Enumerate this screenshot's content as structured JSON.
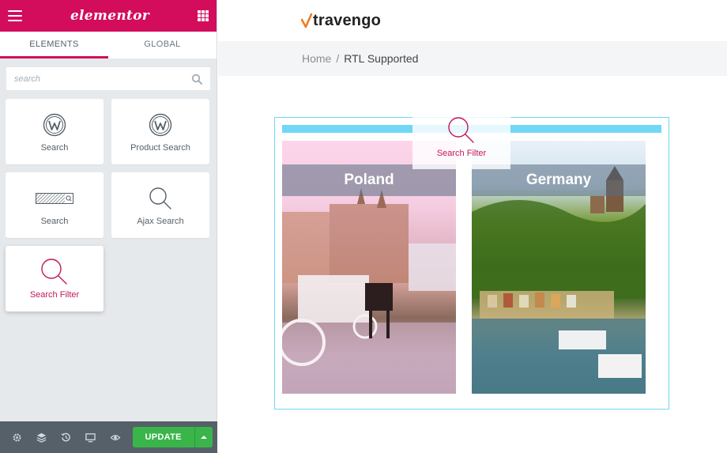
{
  "sidebar": {
    "brand": "elementor",
    "tabs": [
      {
        "label": "ELEMENTS",
        "active": true
      },
      {
        "label": "GLOBAL",
        "active": false
      }
    ],
    "search": {
      "placeholder": "search",
      "value": ""
    },
    "widgets": [
      {
        "label": "Search",
        "icon": "wordpress-icon"
      },
      {
        "label": "Product Search",
        "icon": "wordpress-icon"
      },
      {
        "label": "Search",
        "icon": "search-form-icon"
      },
      {
        "label": "Ajax Search",
        "icon": "magnifier-icon"
      },
      {
        "label": "Search Filter",
        "icon": "magnifier-icon"
      }
    ],
    "bottom": {
      "update_label": "UPDATE"
    }
  },
  "preview": {
    "logo_text": "travengo",
    "breadcrumb": {
      "home": "Home",
      "separator": "/",
      "current": "RTL Supported"
    },
    "cards": [
      {
        "title": "Poland"
      },
      {
        "title": "Germany"
      }
    ],
    "drag_ghost": {
      "label": "Search Filter"
    }
  },
  "colors": {
    "brand": "#d30c5c",
    "highlight_text": "#c2185b",
    "update_green": "#39b54a",
    "section_border": "#71d7f7"
  }
}
